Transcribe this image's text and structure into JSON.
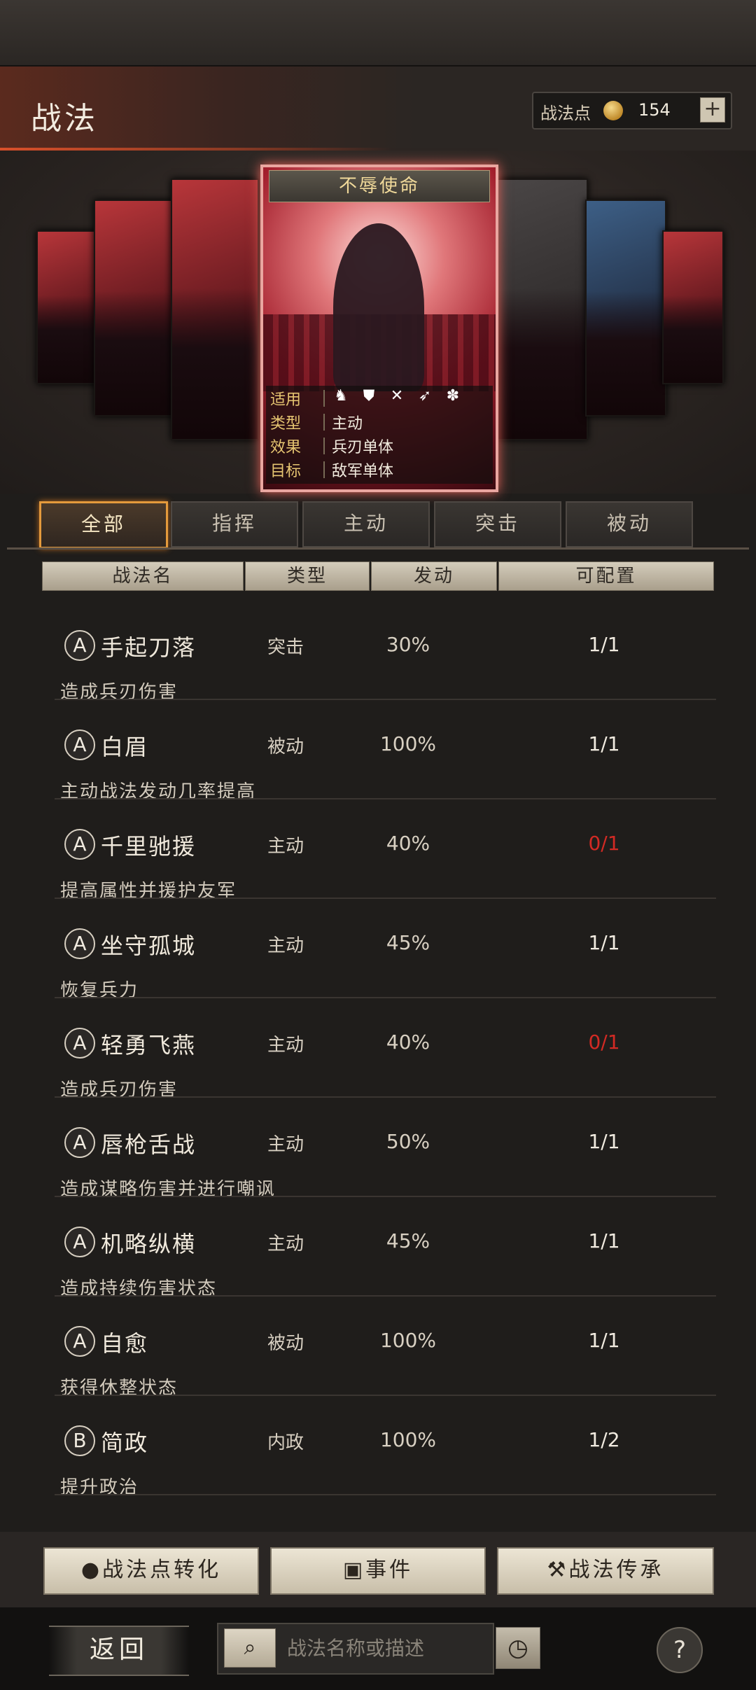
{
  "header": {
    "title": "战法",
    "points_label": "战法点",
    "points_value": "154",
    "plus_label": "+"
  },
  "featured": {
    "name": "不辱使命",
    "rows": [
      {
        "key": "适用",
        "value": ""
      },
      {
        "key": "类型",
        "value": "主动"
      },
      {
        "key": "效果",
        "value": "兵刃单体"
      },
      {
        "key": "目标",
        "value": "敌军单体"
      }
    ],
    "applicable_icons": [
      "cavalry-icon",
      "shield-icon",
      "bow-icon",
      "spear-icon",
      "wheel-icon"
    ]
  },
  "tabs": [
    "全部",
    "指挥",
    "主动",
    "突击",
    "被动"
  ],
  "columns": [
    "战法名",
    "类型",
    "发动",
    "可配置"
  ],
  "skills": [
    {
      "grade": "A",
      "name": "手起刀落",
      "type": "突击",
      "rate": "30%",
      "config": "1/1",
      "config_full": false,
      "desc": "造成兵刃伤害"
    },
    {
      "grade": "A",
      "name": "白眉",
      "type": "被动",
      "rate": "100%",
      "config": "1/1",
      "config_full": false,
      "desc": "主动战法发动几率提高"
    },
    {
      "grade": "A",
      "name": "千里驰援",
      "type": "主动",
      "rate": "40%",
      "config": "0/1",
      "config_full": true,
      "desc": "提高属性并援护友军"
    },
    {
      "grade": "A",
      "name": "坐守孤城",
      "type": "主动",
      "rate": "45%",
      "config": "1/1",
      "config_full": false,
      "desc": "恢复兵力"
    },
    {
      "grade": "A",
      "name": "轻勇飞燕",
      "type": "主动",
      "rate": "40%",
      "config": "0/1",
      "config_full": true,
      "desc": "造成兵刃伤害"
    },
    {
      "grade": "A",
      "name": "唇枪舌战",
      "type": "主动",
      "rate": "50%",
      "config": "1/1",
      "config_full": false,
      "desc": "造成谋略伤害并进行嘲讽"
    },
    {
      "grade": "A",
      "name": "机略纵横",
      "type": "主动",
      "rate": "45%",
      "config": "1/1",
      "config_full": false,
      "desc": "造成持续伤害状态"
    },
    {
      "grade": "A",
      "name": "自愈",
      "type": "被动",
      "rate": "100%",
      "config": "1/1",
      "config_full": false,
      "desc": "获得休整状态"
    },
    {
      "grade": "B",
      "name": "简政",
      "type": "内政",
      "rate": "100%",
      "config": "1/2",
      "config_full": false,
      "desc": "提升政治"
    }
  ],
  "bottom_buttons": {
    "convert": "战法点转化",
    "event": "事件",
    "inherit": "战法传承"
  },
  "nav": {
    "back": "返回",
    "search_placeholder": "战法名称或描述",
    "help": "?"
  },
  "colors": {
    "accent": "#e49a3c",
    "unavailable": "#d22a24"
  }
}
